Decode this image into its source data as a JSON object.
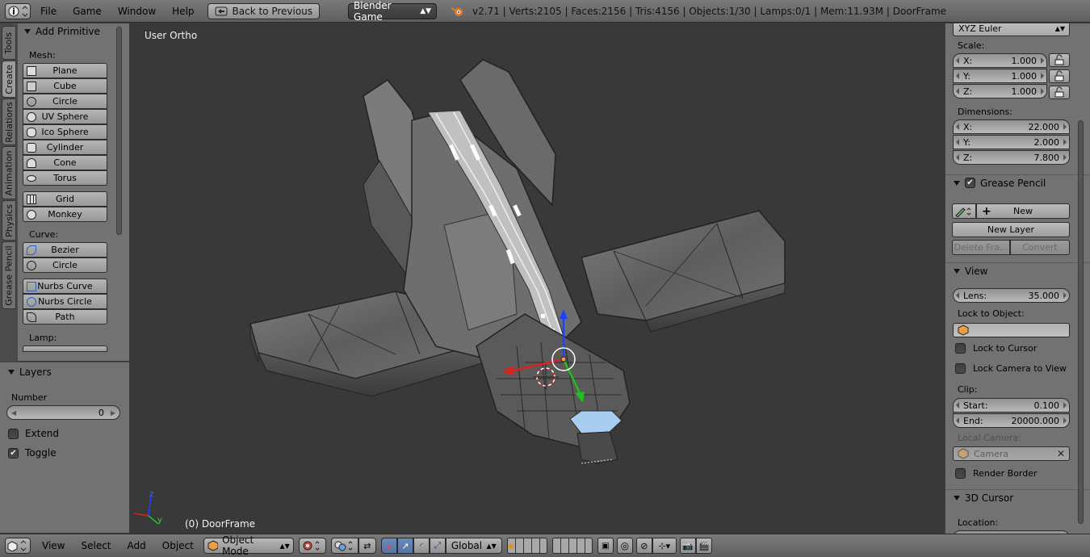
{
  "header": {
    "menus": [
      "File",
      "Game",
      "Window",
      "Help"
    ],
    "back_button": "Back to Previous",
    "engine": "Blender Game",
    "stats": "v2.71 | Verts:2105 | Faces:2156 | Tris:4156 | Objects:1/30 | Lamps:0/1 | Mem:11.93M | DoorFrame"
  },
  "tabs": [
    "Tools",
    "Create",
    "Relations",
    "Animation",
    "Physics",
    "Grease Pencil"
  ],
  "toolshelf": {
    "title": "Add Primitive",
    "mesh_label": "Mesh:",
    "mesh": [
      "Plane",
      "Cube",
      "Circle",
      "UV Sphere",
      "Ico Sphere",
      "Cylinder",
      "Cone",
      "Torus"
    ],
    "mesh2": [
      "Grid",
      "Monkey"
    ],
    "curve_label": "Curve:",
    "curve": [
      "Bezier",
      "Circle"
    ],
    "curve2": [
      "Nurbs Curve",
      "Nurbs Circle",
      "Path"
    ],
    "lamp_label": "Lamp:"
  },
  "layers": {
    "title": "Layers",
    "number_label": "Number",
    "number_value": "0",
    "extend": "Extend",
    "toggle": "Toggle"
  },
  "viewport": {
    "view_name": "User Ortho",
    "object_label": "(0) DoorFrame",
    "axis_z": "z",
    "axis_y": "y"
  },
  "props": {
    "rotation_mode": "XYZ Euler",
    "scale_label": "Scale:",
    "scale": [
      {
        "k": "X:",
        "v": "1.000"
      },
      {
        "k": "Y:",
        "v": "1.000"
      },
      {
        "k": "Z:",
        "v": "1.000"
      }
    ],
    "dimensions_label": "Dimensions:",
    "dimensions": [
      {
        "k": "X:",
        "v": "22.000"
      },
      {
        "k": "Y:",
        "v": "2.000"
      },
      {
        "k": "Z:",
        "v": "7.800"
      }
    ],
    "grease_title": "Grease Pencil",
    "grease_new": "New",
    "grease_new_layer": "New Layer",
    "grease_delete": "Delete Fra...",
    "grease_convert": "Convert",
    "view_title": "View",
    "lens_label": "Lens:",
    "lens_value": "35.000",
    "lock_object_label": "Lock to Object:",
    "lock_cursor": "Lock to Cursor",
    "lock_camera": "Lock Camera to View",
    "clip_label": "Clip:",
    "clip_start_label": "Start:",
    "clip_start": "0.100",
    "clip_end_label": "End:",
    "clip_end": "20000.000",
    "local_camera_label": "Local Camera:",
    "camera_value": "Camera",
    "render_border": "Render Border",
    "cursor_title": "3D Cursor",
    "location_label": "Location:"
  },
  "bottombar": {
    "menus": [
      "View",
      "Select",
      "Add",
      "Object"
    ],
    "mode": "Object Mode",
    "orientation": "Global"
  },
  "colors": {
    "axis_red": "#e02020",
    "axis_green": "#20c020",
    "axis_blue": "#2040ff",
    "selection_blue": "#a9cdf0"
  }
}
